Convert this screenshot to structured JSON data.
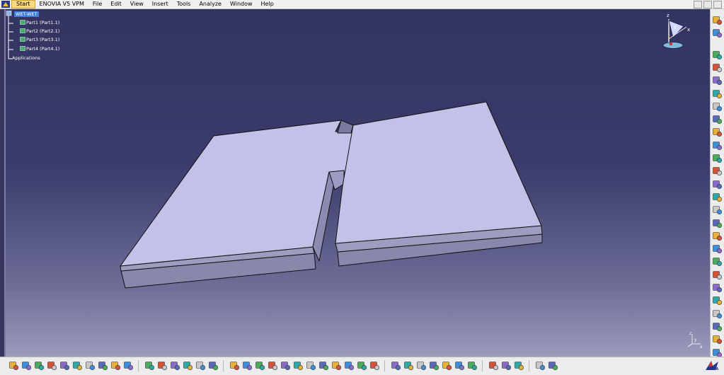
{
  "menubar": {
    "items": [
      {
        "label": "Start",
        "active": true
      },
      {
        "label": "ENOVIA V5 VPM"
      },
      {
        "label": "File"
      },
      {
        "label": "Edit"
      },
      {
        "label": "View"
      },
      {
        "label": "Insert"
      },
      {
        "label": "Tools"
      },
      {
        "label": "Analyze"
      },
      {
        "label": "Window"
      },
      {
        "label": "Help"
      }
    ]
  },
  "spec_tree": {
    "root": "WET-WET",
    "parts": [
      "Part1 (Part1.1)",
      "Part2 (Part2.1)",
      "Part3 (Part3.1)",
      "Part4 (Part4.1)"
    ],
    "applications": "Applications"
  },
  "compass": {
    "axis_x": "x",
    "axis_y": "y",
    "axis_z": "z"
  },
  "axis_indicator": {
    "x": "x",
    "y": "y",
    "z": "z"
  },
  "right_toolbar": {
    "icons": [
      "select-icon",
      "fly-icon",
      "new-part-icon",
      "existing-component-icon",
      "replace-component-icon",
      "graph-tree-icon",
      "generate-numbering-icon",
      "bill-of-material-icon",
      "manipulate-icon",
      "snap-icon",
      "explode-icon",
      "stop-manipulate-icon",
      "reconnect-icon",
      "coincidence-icon",
      "contact-icon",
      "offset-icon",
      "angle-icon",
      "fix-icon",
      "fix-together-icon",
      "update-icon",
      "flexible-icon",
      "change-constraint-icon",
      "reuse-pattern-icon",
      "measure-icon",
      "scene-icon",
      "clash-icon"
    ]
  },
  "bottom_toolbar": {
    "icons": [
      "new-icon",
      "open-icon",
      "save-icon",
      "print-icon",
      "cut-icon",
      "copy-icon",
      "paste-icon",
      "undo-icon",
      "redo-icon",
      "whats-this-icon",
      "formula-icon",
      "knowledge-advisor-icon",
      "catalog-icon",
      "table-icon",
      "design-table-icon",
      "law-icon",
      "fly-mode-icon",
      "fit-all-icon",
      "pan-icon",
      "rotate-icon",
      "zoom-in-icon",
      "zoom-out-icon",
      "normal-view-icon",
      "iso-view-icon",
      "front-view-icon",
      "shading-icon",
      "hide-show-icon",
      "swap-visible-icon",
      "lighting-icon",
      "sketch-icon",
      "sectioning-icon",
      "measure-between-icon",
      "measure-item-icon",
      "inertia-icon",
      "update-all-icon",
      "wireframe-icon",
      "camera-icon",
      "analysis-icon",
      "material-icon",
      "grid-icon"
    ],
    "brand": "CATIA"
  },
  "colors": {
    "background_top": "#343461",
    "background_bottom": "#9b9bbb",
    "part_top_face": "#c2c2e8",
    "part_side_face": "#8b8bb0",
    "selection": "#3f7fe0"
  }
}
